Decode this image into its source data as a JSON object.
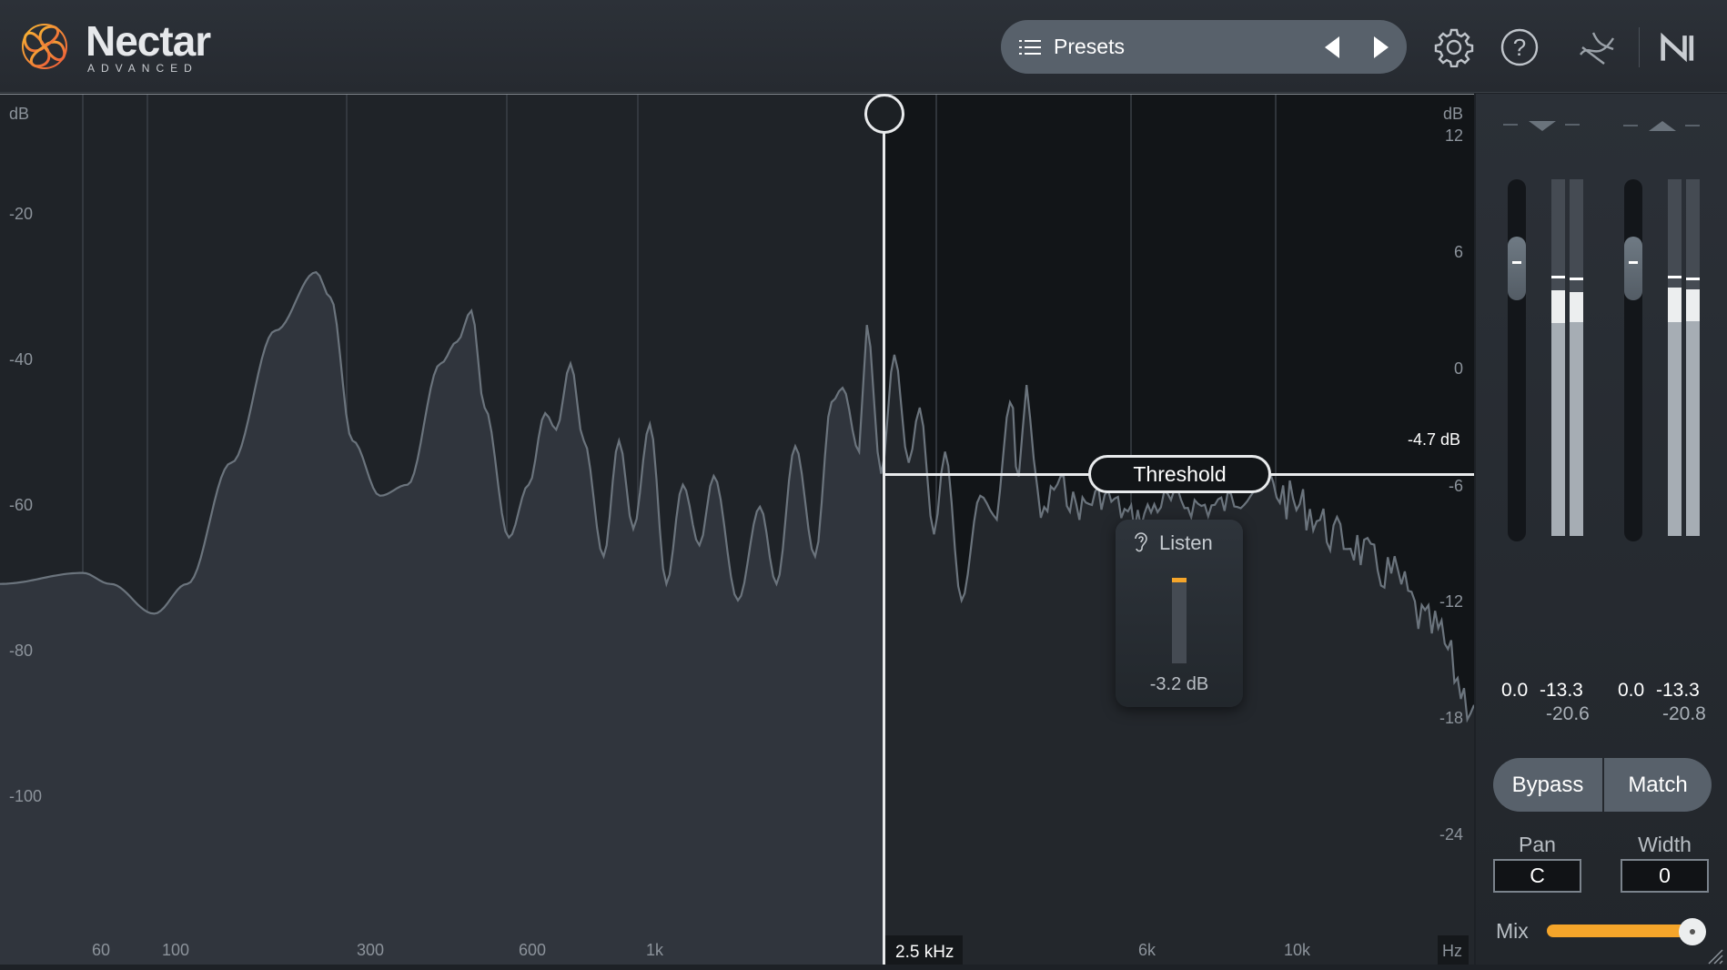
{
  "header": {
    "app_name": "Nectar",
    "edition": "ADVANCED",
    "presets_label": "Presets",
    "icons": [
      "logo-icon",
      "list-icon",
      "prev-arrow-icon",
      "next-arrow-icon",
      "gear-icon",
      "help-icon",
      "signal-chain-icon",
      "ni-logo-icon"
    ]
  },
  "graph": {
    "left_axis": {
      "unit": "dB",
      "ticks": [
        "-20",
        "-40",
        "-60",
        "-80",
        "-100"
      ]
    },
    "right_axis": {
      "unit": "dB",
      "ticks": [
        "12",
        "6",
        "0",
        "-6",
        "-12",
        "-18",
        "-24"
      ]
    },
    "freq_axis": {
      "ticks": [
        "60",
        "100",
        "300",
        "600",
        "1k",
        "6k",
        "10k"
      ],
      "unit": "Hz"
    },
    "crossover_label": "2.5 kHz",
    "threshold": {
      "label": "Threshold",
      "value": "-4.7 dB"
    },
    "listen": {
      "label": "Listen",
      "value": "-3.2 dB"
    }
  },
  "sidebar": {
    "input": {
      "gain": "0.0",
      "peak": "-13.3",
      "rms": "-20.6"
    },
    "output": {
      "gain": "0.0",
      "peak": "-13.3",
      "rms": "-20.8"
    },
    "bypass_label": "Bypass",
    "match_label": "Match",
    "pan": {
      "label": "Pan",
      "value": "C"
    },
    "width": {
      "label": "Width",
      "value": "0"
    },
    "mix": {
      "label": "Mix",
      "value_percent": 100
    },
    "colors": {
      "accent": "#f5a52a"
    }
  }
}
